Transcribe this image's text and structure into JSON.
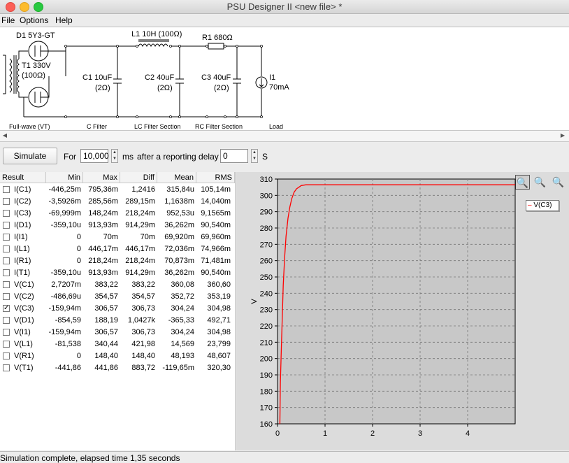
{
  "window": {
    "title": "PSU Designer II  <new file> *"
  },
  "menu": {
    "file": "File",
    "options": "Options",
    "help": "Help"
  },
  "schematic": {
    "d1": "D1 5Y3-GT",
    "t1": "T1 330V",
    "t1_res": "(100Ω)",
    "l1": "L1 10H (100Ω)",
    "r1": "R1 680Ω",
    "c1": "C1 10uF",
    "c1_res": "(2Ω)",
    "c2": "C2 40uF",
    "c2_res": "(2Ω)",
    "c3": "C3 40uF",
    "c3_res": "(2Ω)",
    "i1": "I1",
    "i1_val": "70mA",
    "sections": [
      "Full-wave (VT)",
      "C Filter",
      "LC Filter Section",
      "RC Filter Section",
      "Load"
    ]
  },
  "simulate": {
    "button": "Simulate",
    "for_label": "For",
    "duration": "10,000",
    "ms_label": "ms",
    "delay_label": "after a reporting delay of",
    "delay": "0",
    "s_label": "S"
  },
  "results": {
    "columns": [
      "Result",
      "Min",
      "Max",
      "Diff",
      "Mean",
      "RMS"
    ],
    "rows": [
      {
        "name": "I(C1)",
        "checked": false,
        "min": "-446,25m",
        "max": "795,36m",
        "diff": "1,2416",
        "mean": "315,84u",
        "rms": "105,14m"
      },
      {
        "name": "I(C2)",
        "checked": false,
        "min": "-3,5926m",
        "max": "285,56m",
        "diff": "289,15m",
        "mean": "1,1638m",
        "rms": "14,040m"
      },
      {
        "name": "I(C3)",
        "checked": false,
        "min": "-69,999m",
        "max": "148,24m",
        "diff": "218,24m",
        "mean": "952,53u",
        "rms": "9,1565m"
      },
      {
        "name": "I(D1)",
        "checked": false,
        "min": "-359,10u",
        "max": "913,93m",
        "diff": "914,29m",
        "mean": "36,262m",
        "rms": "90,540m"
      },
      {
        "name": "I(I1)",
        "checked": false,
        "min": "0",
        "max": "70m",
        "diff": "70m",
        "mean": "69,920m",
        "rms": "69,960m"
      },
      {
        "name": "I(L1)",
        "checked": false,
        "min": "0",
        "max": "446,17m",
        "diff": "446,17m",
        "mean": "72,036m",
        "rms": "74,966m"
      },
      {
        "name": "I(R1)",
        "checked": false,
        "min": "0",
        "max": "218,24m",
        "diff": "218,24m",
        "mean": "70,873m",
        "rms": "71,481m"
      },
      {
        "name": "I(T1)",
        "checked": false,
        "min": "-359,10u",
        "max": "913,93m",
        "diff": "914,29m",
        "mean": "36,262m",
        "rms": "90,540m"
      },
      {
        "name": "V(C1)",
        "checked": false,
        "min": "2,7207m",
        "max": "383,22",
        "diff": "383,22",
        "mean": "360,08",
        "rms": "360,60"
      },
      {
        "name": "V(C2)",
        "checked": false,
        "min": "-486,69u",
        "max": "354,57",
        "diff": "354,57",
        "mean": "352,72",
        "rms": "353,19"
      },
      {
        "name": "V(C3)",
        "checked": true,
        "min": "-159,94m",
        "max": "306,57",
        "diff": "306,73",
        "mean": "304,24",
        "rms": "304,98"
      },
      {
        "name": "V(D1)",
        "checked": false,
        "min": "-854,59",
        "max": "188,19",
        "diff": "1,0427k",
        "mean": "-365,33",
        "rms": "492,71"
      },
      {
        "name": "V(I1)",
        "checked": false,
        "min": "-159,94m",
        "max": "306,57",
        "diff": "306,73",
        "mean": "304,24",
        "rms": "304,98"
      },
      {
        "name": "V(L1)",
        "checked": false,
        "min": "-81,538",
        "max": "340,44",
        "diff": "421,98",
        "mean": "14,569",
        "rms": "23,799"
      },
      {
        "name": "V(R1)",
        "checked": false,
        "min": "0",
        "max": "148,40",
        "diff": "148,40",
        "mean": "48,193",
        "rms": "48,607"
      },
      {
        "name": "V(T1)",
        "checked": false,
        "min": "-441,86",
        "max": "441,86",
        "diff": "883,72",
        "mean": "-119,65m",
        "rms": "320,30"
      }
    ]
  },
  "plot": {
    "legend": "V(C3)",
    "tools": [
      "zoom-select-icon",
      "zoom-in-icon",
      "zoom-reset-icon"
    ]
  },
  "chart_data": {
    "type": "line",
    "xlabel": "",
    "ylabel": "V",
    "xlim": [
      0,
      5
    ],
    "ylim": [
      160,
      310
    ],
    "xticks": [
      0,
      1,
      2,
      3,
      4
    ],
    "yticks": [
      160,
      170,
      180,
      190,
      200,
      210,
      220,
      230,
      240,
      250,
      260,
      270,
      280,
      290,
      300,
      310
    ],
    "grid": true,
    "legend_position": "top-right",
    "series": [
      {
        "name": "V(C3)",
        "color": "#ff0000",
        "x": [
          0.05,
          0.06,
          0.08,
          0.1,
          0.12,
          0.15,
          0.18,
          0.22,
          0.26,
          0.3,
          0.35,
          0.4,
          0.5,
          0.6,
          1.0,
          2.0,
          3.0,
          4.0,
          5.0
        ],
        "y": [
          160,
          185,
          205,
          225,
          245,
          262,
          275,
          286,
          293,
          298,
          302,
          304,
          306,
          306.5,
          306.5,
          306.5,
          306.5,
          306.5,
          306.5
        ]
      }
    ]
  },
  "status": {
    "text": "Simulation complete, elapsed time 1,35 seconds"
  }
}
